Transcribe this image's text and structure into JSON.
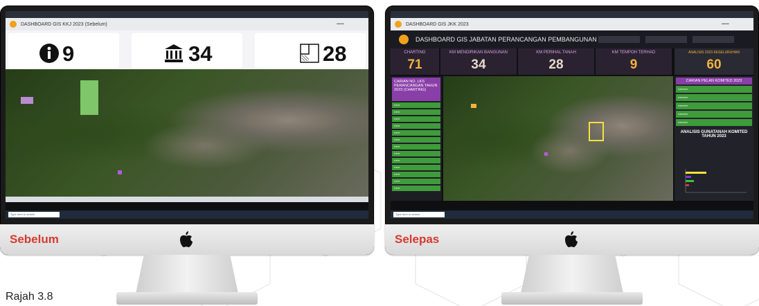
{
  "caption": "Rajah 3.8",
  "colors": {
    "label_red": "#d63a2e",
    "screen_purple": "#8a3fa8",
    "screen_green": "#3f9b3b",
    "kpi_orange": "#f2b33d"
  },
  "before": {
    "label": "Sebelum",
    "dashboard_title": "DASHBOARD GIS KKJ 2023 (Sebelum)",
    "stats": [
      {
        "icon": "info-icon",
        "value": "9"
      },
      {
        "icon": "building-icon",
        "value": "34"
      },
      {
        "icon": "land-parcel-icon",
        "value": "28"
      }
    ],
    "search_placeholder": "Type here to search"
  },
  "after": {
    "label": "Selepas",
    "browser_title": "DASHBOARD GIS JKK 2023",
    "dashboard_title": "DASHBOARD GIS JABATAN PERANCANGAN PEMBANGUNAN",
    "kpis": [
      {
        "label": "CHARTING",
        "value": "71"
      },
      {
        "label": "KM MENDIRIKAN BANGUNAN",
        "value": "34"
      },
      {
        "label": "KM PERIHAL TANAH",
        "value": "28"
      },
      {
        "label": "KM TEMPOH TERHAD",
        "value": "9"
      },
      {
        "label": "ANALISIS 2023 KESELURUHAN",
        "value": "60"
      }
    ],
    "side_heading": "CARIAN NO. LKS PERANCANGAN TAHUN 2023 (CHARTING)",
    "right_heading": "CARIAN PELAN KOMITED 2023",
    "right_heading_2": "ANALISIS GUNATANAH KOMITED TAHUN 2023",
    "search_placeholder": "Type here to search"
  }
}
